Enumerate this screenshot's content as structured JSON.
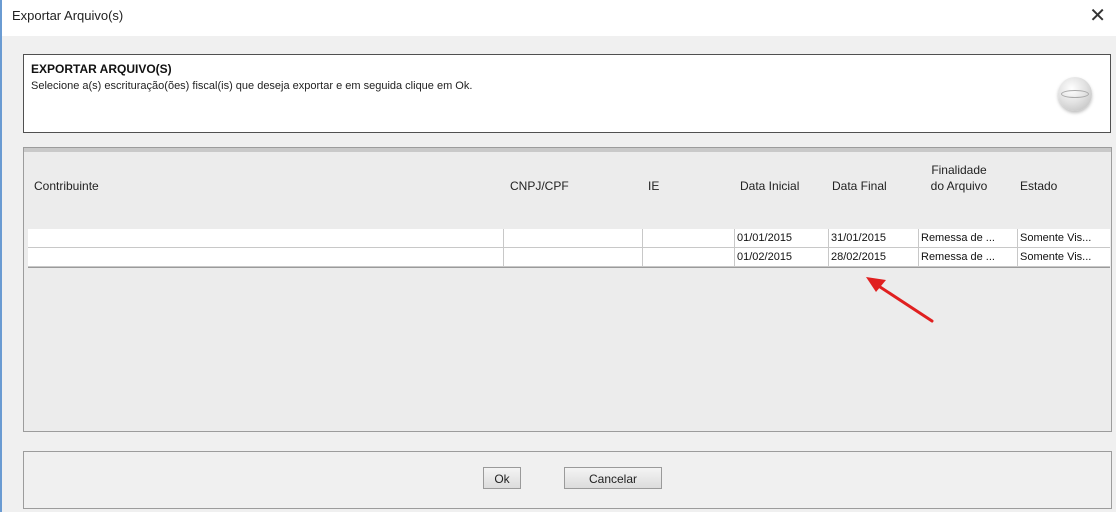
{
  "window": {
    "title": "Exportar Arquivo(s)",
    "close_icon": "close-icon"
  },
  "header": {
    "title": "EXPORTAR ARQUIVO(S)",
    "description": "Selecione a(s) escrituração(ões) fiscal(is) que deseja exportar e em seguida clique em Ok.",
    "logo_icon": "app-logo-icon"
  },
  "table": {
    "columns": {
      "contribuinte": "Contribuinte",
      "cnpj": "CNPJ/CPF",
      "ie": "IE",
      "data_inicial": "Data Inicial",
      "data_final": "Data Final",
      "finalidade_line1": "Finalidade",
      "finalidade_line2": "do Arquivo",
      "estado": "Estado"
    },
    "rows": [
      {
        "contribuinte": "",
        "cnpj": "",
        "ie": "",
        "data_inicial": "01/01/2015",
        "data_final": "31/01/2015",
        "finalidade": "Remessa de ...",
        "estado": "Somente Vis..."
      },
      {
        "contribuinte": "",
        "cnpj": "",
        "ie": "",
        "data_inicial": "01/02/2015",
        "data_final": "28/02/2015",
        "finalidade": "Remessa de ...",
        "estado": "Somente Vis..."
      }
    ]
  },
  "annotation": {
    "arrow_color": "#e02020",
    "icon": "red-arrow-icon"
  },
  "footer": {
    "ok_label": "Ok",
    "cancel_label": "Cancelar"
  }
}
